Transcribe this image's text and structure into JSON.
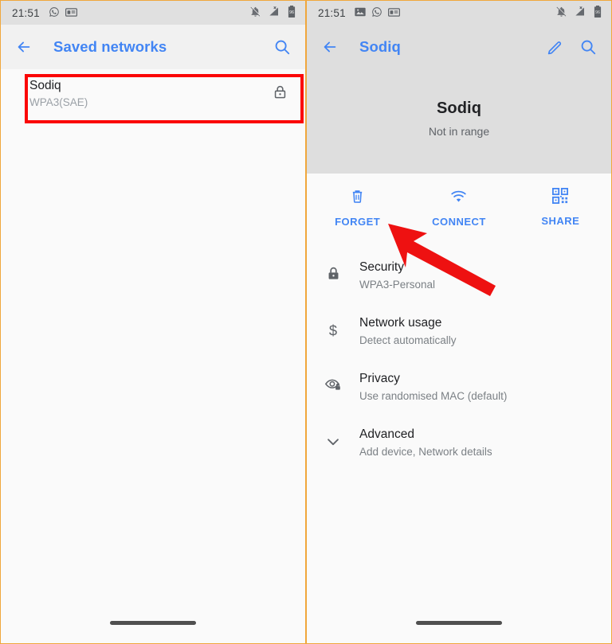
{
  "left_screen": {
    "status_bar": {
      "time": "21:51",
      "left_icons": [
        "whatsapp-icon",
        "gb-card-icon"
      ],
      "right_icons": [
        "notifications-off-icon",
        "signal-no-service-icon",
        "battery-icon"
      ],
      "battery_level": "96"
    },
    "app_bar": {
      "back_label": "back-arrow-icon",
      "title": "Saved networks",
      "search_label": "search-icon"
    },
    "networks": [
      {
        "name": "Sodiq",
        "security": "WPA3(SAE)",
        "lock": "lock-icon",
        "highlighted": true
      }
    ],
    "nav_bar": {
      "pill": "home-gesture-pill"
    }
  },
  "right_screen": {
    "status_bar": {
      "time": "21:51",
      "left_icons": [
        "photo-icon",
        "whatsapp-icon",
        "gb-card-icon"
      ],
      "right_icons": [
        "notifications-off-icon",
        "signal-no-service-icon",
        "battery-icon"
      ],
      "battery_level": "96"
    },
    "app_bar": {
      "back_label": "back-arrow-icon",
      "title": "Sodiq",
      "edit_label": "pencil-edit-icon",
      "search_label": "search-icon"
    },
    "hero": {
      "ssid": "Sodiq",
      "status": "Not in range"
    },
    "actions": [
      {
        "label": "FORGET",
        "icon": "trash-icon"
      },
      {
        "label": "CONNECT",
        "icon": "wifi-icon"
      },
      {
        "label": "SHARE",
        "icon": "qr-code-icon"
      }
    ],
    "details": [
      {
        "icon": "lock-icon",
        "title": "Security",
        "value": "WPA3-Personal"
      },
      {
        "icon": "dollar-icon",
        "title": "Network usage",
        "value": "Detect automatically"
      },
      {
        "icon": "eye-privacy-icon",
        "title": "Privacy",
        "value": "Use randomised MAC (default)"
      },
      {
        "icon": "chevron-down-icon",
        "title": "Advanced",
        "value": "Add device, Network details"
      }
    ],
    "nav_bar": {
      "pill": "home-gesture-pill"
    }
  },
  "annotations": {
    "highlight_box_color": "#fb0606",
    "arrow_color": "#ee1111",
    "arrow_target": "FORGET",
    "panel_border_color": "#f0a73c"
  },
  "colors": {
    "accent_blue": "#4285f4",
    "status_bg": "#dedede",
    "appbar_left_bg": "#f1f1f1",
    "body_bg": "#fafafa",
    "primary_text": "#202124",
    "secondary_text": "#7b8085"
  }
}
